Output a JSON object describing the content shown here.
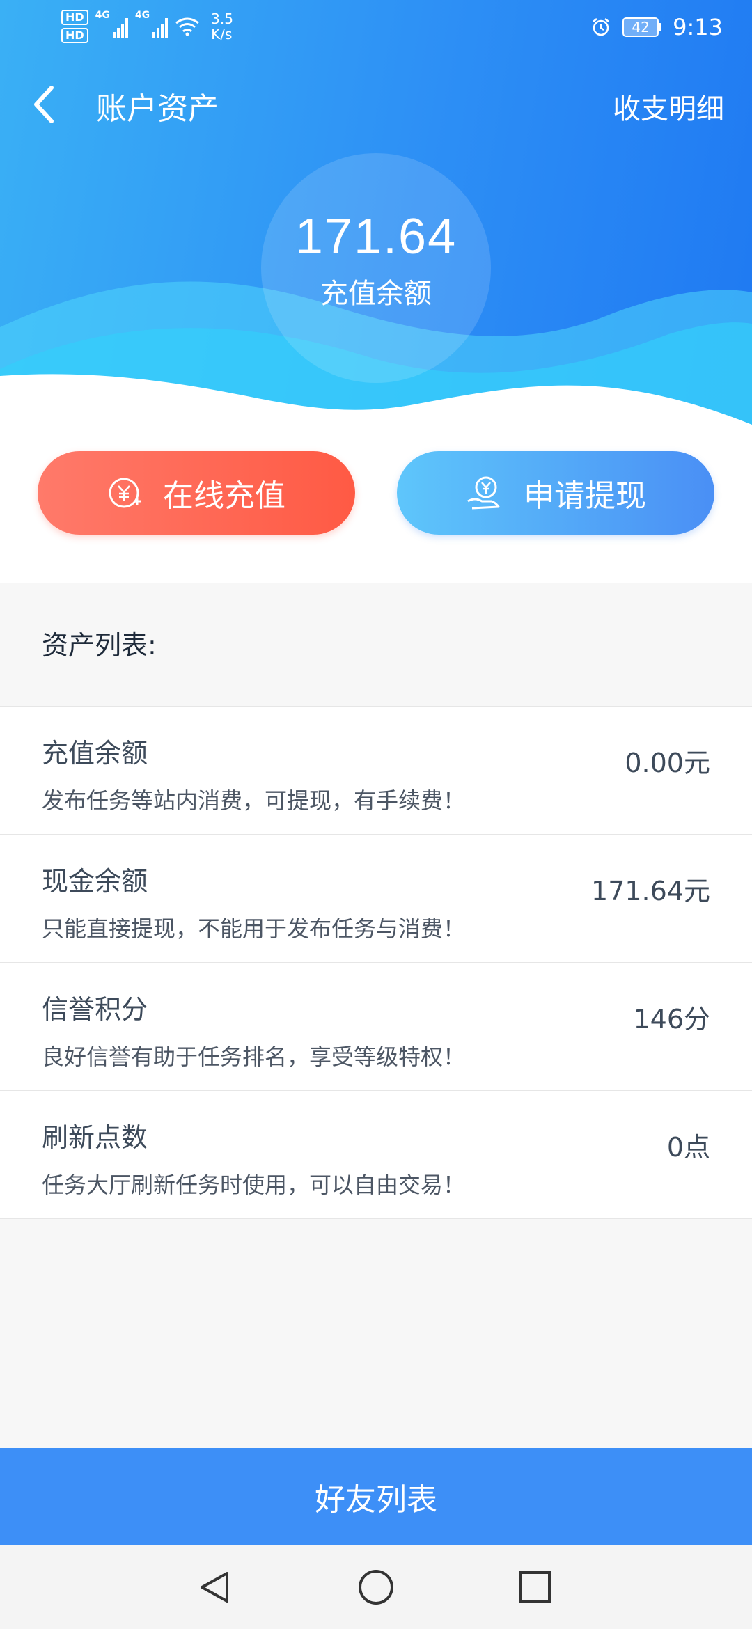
{
  "status_bar": {
    "sim1": "HD",
    "sim2": "HD",
    "net1": "4G",
    "net2": "4G",
    "speed_value": "3.5",
    "speed_unit": "K/s",
    "battery": "42",
    "time": "9:13",
    "icons": [
      "hd-icon",
      "signal-icon",
      "wifi-icon",
      "alarm-icon",
      "battery-icon"
    ]
  },
  "navbar": {
    "title": "账户资产",
    "right_link": "收支明细"
  },
  "balance": {
    "amount": "171.64",
    "label": "充值余额"
  },
  "actions": {
    "recharge": "在线充值",
    "withdraw": "申请提现"
  },
  "asset_list": {
    "heading": "资产列表:",
    "items": [
      {
        "name": "充值余额",
        "desc": "发布任务等站内消费，可提现，有手续费！",
        "value": "0.00元"
      },
      {
        "name": "现金余额",
        "desc": "只能直接提现，不能用于发布任务与消费！",
        "value": "171.64元"
      },
      {
        "name": "信誉积分",
        "desc": "良好信誉有助于任务排名，享受等级特权！",
        "value": "146分"
      },
      {
        "name": "刷新点数",
        "desc": "任务大厅刷新任务时使用，可以自由交易！",
        "value": "0点"
      }
    ]
  },
  "footer": {
    "friends_button": "好友列表"
  },
  "colors": {
    "header_start": "#3ab0f5",
    "header_end": "#1f79f2",
    "recharge_button": "#ff5a44",
    "withdraw_button": "#4a8ff5",
    "bottom_button": "#3d8ff7"
  }
}
